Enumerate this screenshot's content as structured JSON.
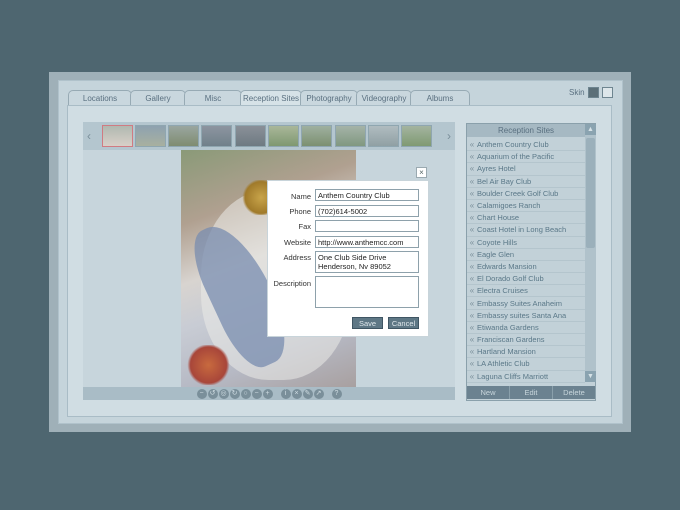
{
  "tabs": [
    "Locations",
    "Gallery",
    "Misc",
    "Reception Sites",
    "Photography",
    "Videography",
    "Albums"
  ],
  "active_tab": "Reception Sites",
  "skin": {
    "label": "Skin"
  },
  "list": {
    "header": "Reception Sites",
    "items": [
      "Anthem Country Club",
      "Aquarium of the Pacific",
      "Ayres Hotel",
      "Bel Air Bay Club",
      "Boulder Creek Golf Club",
      "Calamigoes Ranch",
      "Chart House",
      "Coast Hotel in Long Beach",
      "Coyote Hills",
      "Eagle Glen",
      "Edwards Mansion",
      "El Dorado Golf Club",
      "Electra Cruises",
      "Embassy Suites Anaheim",
      "Embassy suites Santa Ana",
      "Etiwanda Gardens",
      "Franciscan Gardens",
      "Hartland Mansion",
      "LA Athletic Club",
      "Laguna Cliffs Marriott"
    ],
    "footer": {
      "new": "New",
      "edit": "Edit",
      "delete": "Delete"
    }
  },
  "dialog": {
    "name_label": "Name",
    "name_value": "Anthem Country Club",
    "phone_label": "Phone",
    "phone_value": "(702)614-5002",
    "fax_label": "Fax",
    "fax_value": "",
    "website_label": "Website",
    "website_value": "http://www.anthemcc.com",
    "address_label": "Address",
    "address_value": "One Club Side Drive\nHenderson, Nv 89052",
    "description_label": "Description",
    "description_value": "",
    "save_label": "Save",
    "cancel_label": "Cancel",
    "close_glyph": "×"
  },
  "toolbar_icons": [
    "zoom-out-icon",
    "rotate-left-icon",
    "fit-icon",
    "rotate-right-icon",
    "zoom-reset-icon",
    "minus-icon",
    "plus-icon",
    "info-icon",
    "close-icon",
    "edit-icon",
    "share-icon",
    "help-icon"
  ],
  "toolbar": {
    "help_glyph": "?"
  },
  "colors": {
    "background": "#4e6670",
    "panel": "#c5d4db",
    "accent": "#5e7785"
  }
}
